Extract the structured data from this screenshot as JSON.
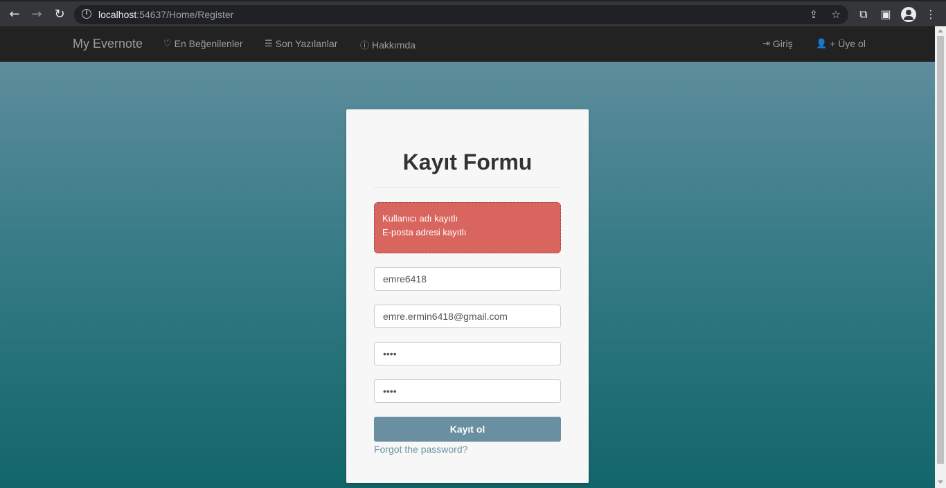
{
  "browser": {
    "url_host": "localhost",
    "url_rest": ":54637/Home/Register"
  },
  "navbar": {
    "brand": "My Evernote",
    "links": [
      {
        "label": "En Beğenilenler",
        "icon": "heart-icon"
      },
      {
        "label": "Son Yazılanlar",
        "icon": "list-icon"
      },
      {
        "label": "Hakkımda",
        "icon": "info-icon"
      }
    ],
    "right_links": [
      {
        "label": "Giriş",
        "icon": "login-icon"
      },
      {
        "label": "+ Üye ol",
        "icon": "user-icon"
      }
    ]
  },
  "form": {
    "title": "Kayıt Formu",
    "errors": [
      "Kullanıcı adı kayıtlı",
      "E-posta adresi kayıtlı"
    ],
    "username_value": "emre6418",
    "email_value": "emre.ermin6418@gmail.com",
    "password_value": "1234",
    "repassword_value": "1234",
    "submit_label": "Kayıt ol",
    "forgot_label": "Forgot the password?"
  },
  "colors": {
    "navbar": "#222222",
    "alert": "#d9655f",
    "button": "#6a8fa0",
    "link": "#6c94a6"
  }
}
